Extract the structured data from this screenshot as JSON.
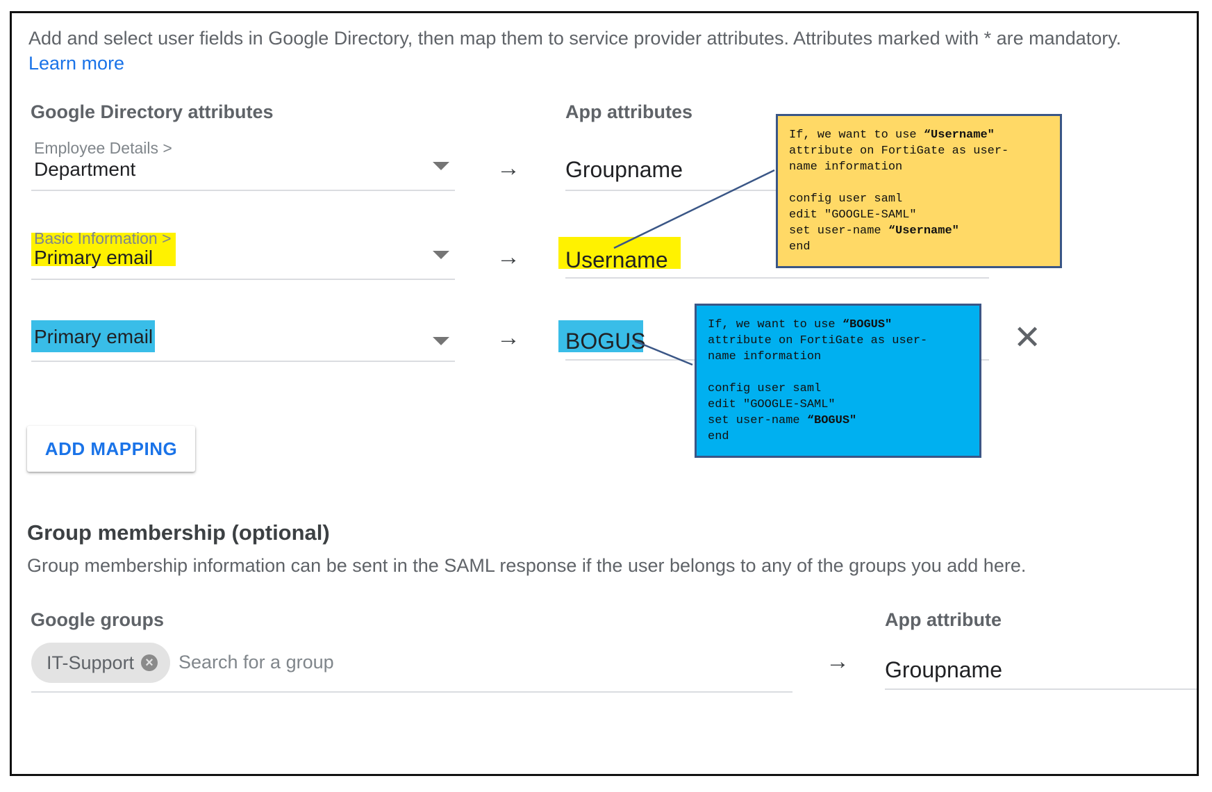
{
  "intro": {
    "text": "Add and select user fields in Google Directory, then map them to service provider attributes. Attributes marked with * are mandatory.",
    "learn_more": "Learn more"
  },
  "attributes": {
    "google_header": "Google Directory attributes",
    "app_header": "App attributes",
    "arrow": "→",
    "rows": [
      {
        "category": "Employee Details >",
        "value": "Department",
        "app_value": "Groupname"
      },
      {
        "category": "Basic Information >",
        "value": "Primary email",
        "app_value": "Username"
      },
      {
        "category": "",
        "value": "Primary email",
        "app_value": "BOGUS"
      }
    ],
    "remove_icon": "close-icon"
  },
  "add_mapping": "ADD MAPPING",
  "group_membership": {
    "title": "Group membership (optional)",
    "description": "Group membership information can be sent in the SAML response if the user belongs to any of the groups you add here.",
    "google_groups_header": "Google groups",
    "app_attribute_header": "App attribute",
    "chip_label": "IT-Support",
    "search_placeholder": "Search for a group",
    "arrow": "→",
    "app_value": "Groupname"
  },
  "annotations": {
    "yellow": {
      "color": "#ffd966",
      "line1_pre": "If, we want to use ",
      "line1_bold": "“Username\"",
      "line2": "attribute on FortiGate as user-",
      "line3": "name information",
      "line4": "config user saml",
      "line5": "edit \"GOOGLE-SAML\"",
      "line6_pre": "set user-name ",
      "line6_bold": "“Username\"",
      "line7": "end"
    },
    "blue": {
      "color": "#00b0f0",
      "line1_pre": "If, we want to use ",
      "line1_bold": "“BOGUS\"",
      "line2": "attribute on FortiGate as user-",
      "line3": "name information",
      "line4": "config user saml",
      "line5": "edit \"GOOGLE-SAML\"",
      "line6_pre": "set user-name ",
      "line6_bold": "“BOGUS\"",
      "line7": "end"
    }
  },
  "highlight_colors": {
    "row2": "#fff200",
    "row3": "#39bde8"
  }
}
